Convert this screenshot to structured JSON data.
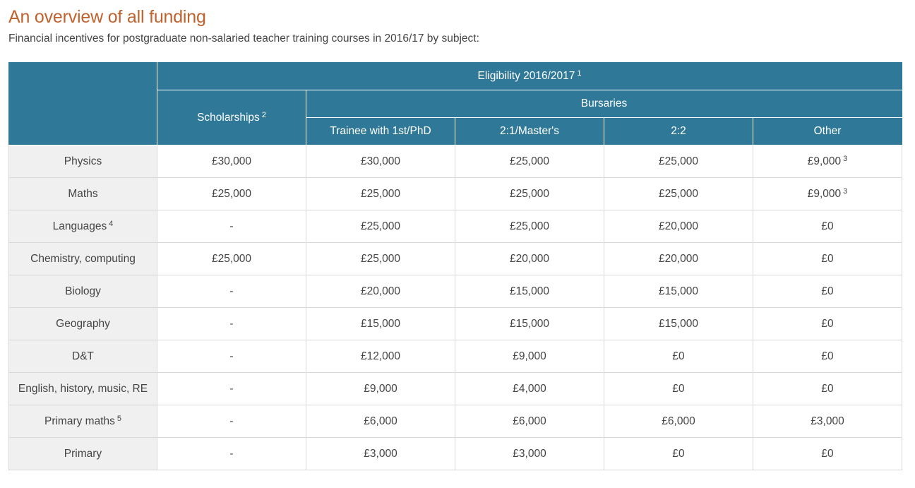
{
  "page": {
    "title": "An overview of all funding",
    "subtitle": "Financial incentives for postgraduate non-salaried teacher training courses in 2016/17 by subject:"
  },
  "table": {
    "header": {
      "eligibility": "Eligibility 2016/2017",
      "eligibility_note": "1",
      "scholarships": "Scholarships",
      "scholarships_note": "2",
      "bursaries": "Bursaries",
      "bursary_columns": [
        "Trainee with 1st/PhD",
        "2:1/Master's",
        "2:2",
        "Other"
      ]
    },
    "rows": [
      {
        "subject": "Physics",
        "subject_note": "",
        "scholarship": "£30,000",
        "first_phd": "£30,000",
        "two_one": "£25,000",
        "two_two": "£25,000",
        "other": "£9,000",
        "other_note": "3"
      },
      {
        "subject": "Maths",
        "subject_note": "",
        "scholarship": "£25,000",
        "first_phd": "£25,000",
        "two_one": "£25,000",
        "two_two": "£25,000",
        "other": "£9,000",
        "other_note": "3"
      },
      {
        "subject": "Languages",
        "subject_note": "4",
        "scholarship": "-",
        "first_phd": "£25,000",
        "two_one": "£25,000",
        "two_two": "£20,000",
        "other": "£0",
        "other_note": ""
      },
      {
        "subject": "Chemistry, computing",
        "subject_note": "",
        "scholarship": "£25,000",
        "first_phd": "£25,000",
        "two_one": "£20,000",
        "two_two": "£20,000",
        "other": "£0",
        "other_note": ""
      },
      {
        "subject": "Biology",
        "subject_note": "",
        "scholarship": "-",
        "first_phd": "£20,000",
        "two_one": "£15,000",
        "two_two": "£15,000",
        "other": "£0",
        "other_note": ""
      },
      {
        "subject": "Geography",
        "subject_note": "",
        "scholarship": "-",
        "first_phd": "£15,000",
        "two_one": "£15,000",
        "two_two": "£15,000",
        "other": "£0",
        "other_note": ""
      },
      {
        "subject": "D&T",
        "subject_note": "",
        "scholarship": "-",
        "first_phd": "£12,000",
        "two_one": "£9,000",
        "two_two": "£0",
        "other": "£0",
        "other_note": ""
      },
      {
        "subject": "English, history, music, RE",
        "subject_note": "",
        "scholarship": "-",
        "first_phd": "£9,000",
        "two_one": "£4,000",
        "two_two": "£0",
        "other": "£0",
        "other_note": ""
      },
      {
        "subject": "Primary maths",
        "subject_note": "5",
        "scholarship": "-",
        "first_phd": "£6,000",
        "two_one": "£6,000",
        "two_two": "£6,000",
        "other": "£3,000",
        "other_note": ""
      },
      {
        "subject": "Primary",
        "subject_note": "",
        "scholarship": "-",
        "first_phd": "£3,000",
        "two_one": "£3,000",
        "two_two": "£0",
        "other": "£0",
        "other_note": ""
      }
    ]
  },
  "colors": {
    "title": "#c0622d",
    "header_bg": "#2f7898",
    "subject_bg": "#f0f0f0"
  }
}
